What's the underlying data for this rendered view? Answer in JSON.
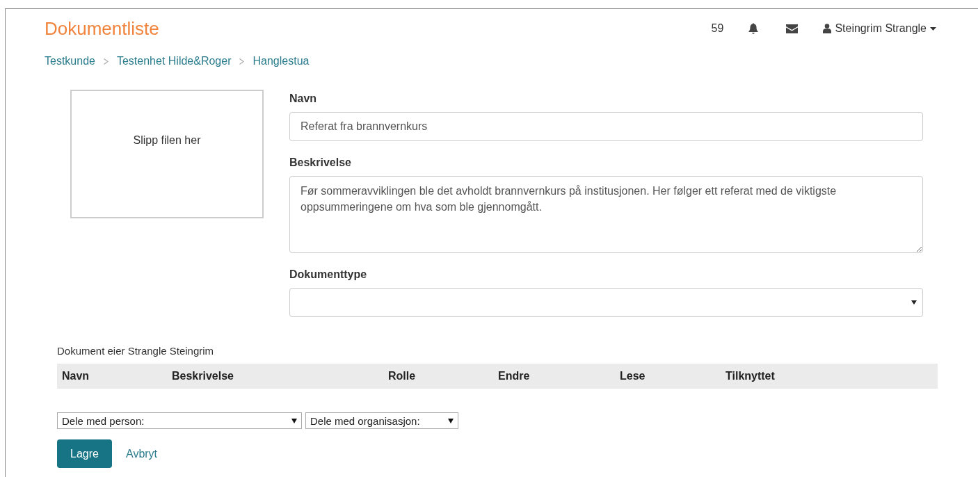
{
  "header": {
    "title": "Dokumentliste",
    "count": "59",
    "user": "Steingrim Strangle"
  },
  "breadcrumbs": [
    "Testkunde",
    "Testenhet Hilde&Roger",
    "Hanglestua"
  ],
  "dropzone": {
    "label": "Slipp filen her"
  },
  "form": {
    "name_label": "Navn",
    "name_value": "Referat fra brannvernkurs",
    "description_label": "Beskrivelse",
    "description_value": "Før sommeravviklingen ble det avholdt brannvernkurs på institusjonen. Her følger ett referat med de viktigste oppsummeringene om hva som ble gjennomgått.",
    "type_label": "Dokumenttype"
  },
  "owner": "Dokument eier Strangle Steingrim",
  "table": {
    "columns": [
      "Navn",
      "Beskrivelse",
      "Rolle",
      "Endre",
      "Lese",
      "Tilknyttet"
    ]
  },
  "share": {
    "person": "Dele med person:",
    "organisation": "Dele med organisasjon:"
  },
  "buttons": {
    "save": "Lagre",
    "cancel": "Avbryt"
  }
}
